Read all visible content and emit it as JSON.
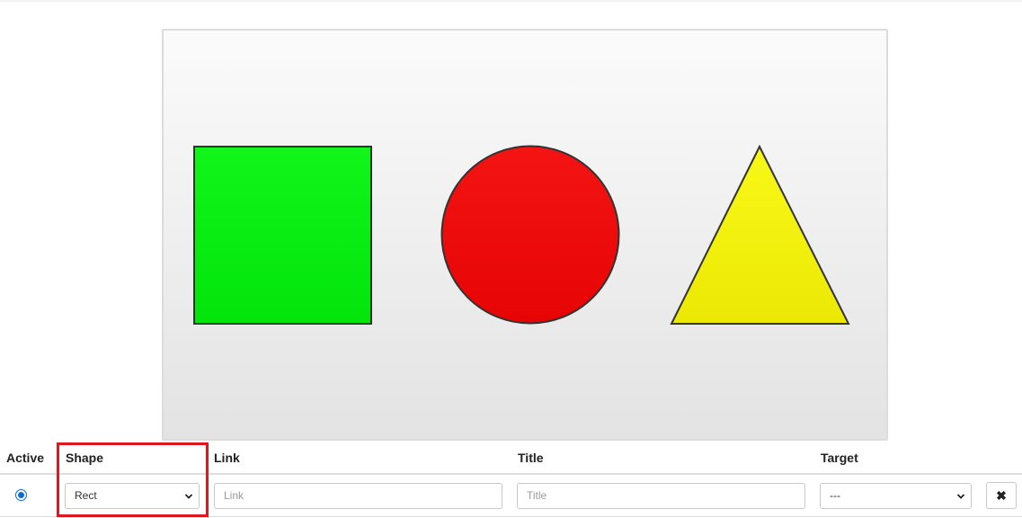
{
  "canvas": {
    "shapes": [
      {
        "kind": "rect",
        "fill_top": "#12f51a",
        "fill_bottom": "#02e40a"
      },
      {
        "kind": "circle",
        "fill_top": "#f41414",
        "fill_bottom": "#e60404"
      },
      {
        "kind": "triangle",
        "fill_top": "#f8f818",
        "fill_bottom": "#ece804"
      }
    ],
    "stroke_color": "#333333"
  },
  "table": {
    "headers": {
      "active": "Active",
      "shape": "Shape",
      "link": "Link",
      "title": "Title",
      "target": "Target"
    },
    "row": {
      "active": true,
      "shape_value": "Rect",
      "link_placeholder": "Link",
      "title_placeholder": "Title",
      "target_value": "---",
      "remove_icon": "close-icon"
    }
  },
  "highlight_color": "#e2161e"
}
